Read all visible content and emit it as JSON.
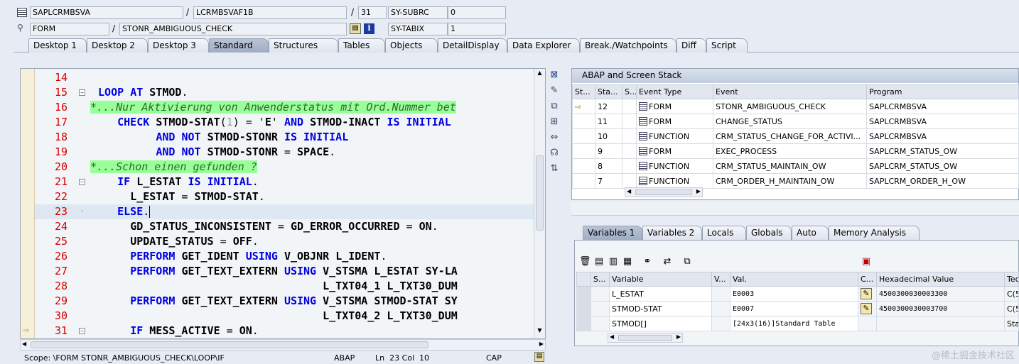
{
  "header": {
    "program": "SAPLCRMBSVA",
    "include": "LCRMBSVAF1B",
    "line": "31",
    "sy_subrc_label": "SY-SUBRC",
    "sy_subrc_value": "0",
    "event_type": "FORM",
    "event_name": "STONR_AMBIGUOUS_CHECK",
    "sy_tabix_label": "SY-TABIX",
    "sy_tabix_value": "1",
    "slash": "/"
  },
  "tabs": [
    "Desktop 1",
    "Desktop 2",
    "Desktop 3",
    "Standard",
    "Structures",
    "Tables",
    "Objects",
    "DetailDisplay",
    "Data Explorer",
    "Break./Watchpoints",
    "Diff",
    "Script"
  ],
  "active_tab": "Standard",
  "code": {
    "lines": [
      {
        "n": "14",
        "t": ""
      },
      {
        "n": "15",
        "t": " LOOP AT STMOD."
      },
      {
        "n": "16",
        "t": "*...Nur Aktivierung von Anwenderstatus mit Ord.Nummer bet"
      },
      {
        "n": "17",
        "t": "    CHECK STMOD-STAT(1) = 'E' AND STMOD-INACT IS INITIAL"
      },
      {
        "n": "18",
        "t": "          AND NOT STMOD-STONR IS INITIAL"
      },
      {
        "n": "19",
        "t": "          AND NOT STMOD-STONR = SPACE."
      },
      {
        "n": "20",
        "t": "*...Schon einen gefunden ?"
      },
      {
        "n": "21",
        "t": "    IF L_ESTAT IS INITIAL."
      },
      {
        "n": "22",
        "t": "      L_ESTAT = STMOD-STAT."
      },
      {
        "n": "23",
        "t": "    ELSE."
      },
      {
        "n": "24",
        "t": "      GD_STATUS_INCONSISTENT = GD_ERROR_OCCURRED = ON."
      },
      {
        "n": "25",
        "t": "      UPDATE_STATUS = OFF."
      },
      {
        "n": "26",
        "t": "      PERFORM GET_IDENT USING V_OBJNR L_IDENT."
      },
      {
        "n": "27",
        "t": "      PERFORM GET_TEXT_EXTERN USING V_STSMA L_ESTAT SY-LA"
      },
      {
        "n": "28",
        "t": "                                    L_TXT04_1 L_TXT30_DUM"
      },
      {
        "n": "29",
        "t": "      PERFORM GET_TEXT_EXTERN USING V_STSMA STMOD-STAT SY"
      },
      {
        "n": "30",
        "t": "                                    L_TXT04_2 L_TXT30_DUM"
      },
      {
        "n": "31",
        "t": "      IF MESS_ACTIVE = ON."
      }
    ]
  },
  "status": {
    "scope": "Scope: \\FORM STONR_AMBIGUOUS_CHECK\\LOOP\\IF",
    "lang": "ABAP",
    "position": "Ln  23 Col  10",
    "caps": "CAP"
  },
  "stack": {
    "title": "ABAP and Screen Stack",
    "columns": [
      "St...",
      "Sta...",
      "S...",
      "Event Type",
      "Event",
      "Program"
    ],
    "rows": [
      {
        "level": "12",
        "type": "FORM",
        "event": "STONR_AMBIGUOUS_CHECK",
        "program": "SAPLCRMBSVA",
        "current": true
      },
      {
        "level": "11",
        "type": "FORM",
        "event": "CHANGE_STATUS",
        "program": "SAPLCRMBSVA"
      },
      {
        "level": "10",
        "type": "FUNCTION",
        "event": "CRM_STATUS_CHANGE_FOR_ACTIVI...",
        "program": "SAPLCRMBSVA"
      },
      {
        "level": "9",
        "type": "FORM",
        "event": "EXEC_PROCESS",
        "program": "SAPLCRM_STATUS_OW"
      },
      {
        "level": "8",
        "type": "FUNCTION",
        "event": "CRM_STATUS_MAINTAIN_OW",
        "program": "SAPLCRM_STATUS_OW"
      },
      {
        "level": "7",
        "type": "FUNCTION",
        "event": "CRM_ORDER_H_MAINTAIN_OW",
        "program": "SAPLCRM_ORDER_H_OW"
      }
    ]
  },
  "var_tabs": [
    "Variables 1",
    "Variables 2",
    "Locals",
    "Globals",
    "Auto",
    "Memory Analysis"
  ],
  "active_var_tab": "Variables 1",
  "variables": {
    "columns": [
      "S...",
      "Variable",
      "V...",
      "Val.",
      "C...",
      "Hexadecimal Value",
      "Tec"
    ],
    "rows": [
      {
        "name": "L_ESTAT",
        "value": "E0003",
        "hex": "4500300030003300",
        "tec": "C(5"
      },
      {
        "name": "STMOD-STAT",
        "value": "E0007",
        "hex": "4500300030003700",
        "tec": "C(5"
      },
      {
        "name": "STMOD[]",
        "value": "[24x3(16)]Standard Table",
        "hex": "",
        "tec": "Stan"
      }
    ]
  },
  "watermark": "@稀土掘金技术社区"
}
